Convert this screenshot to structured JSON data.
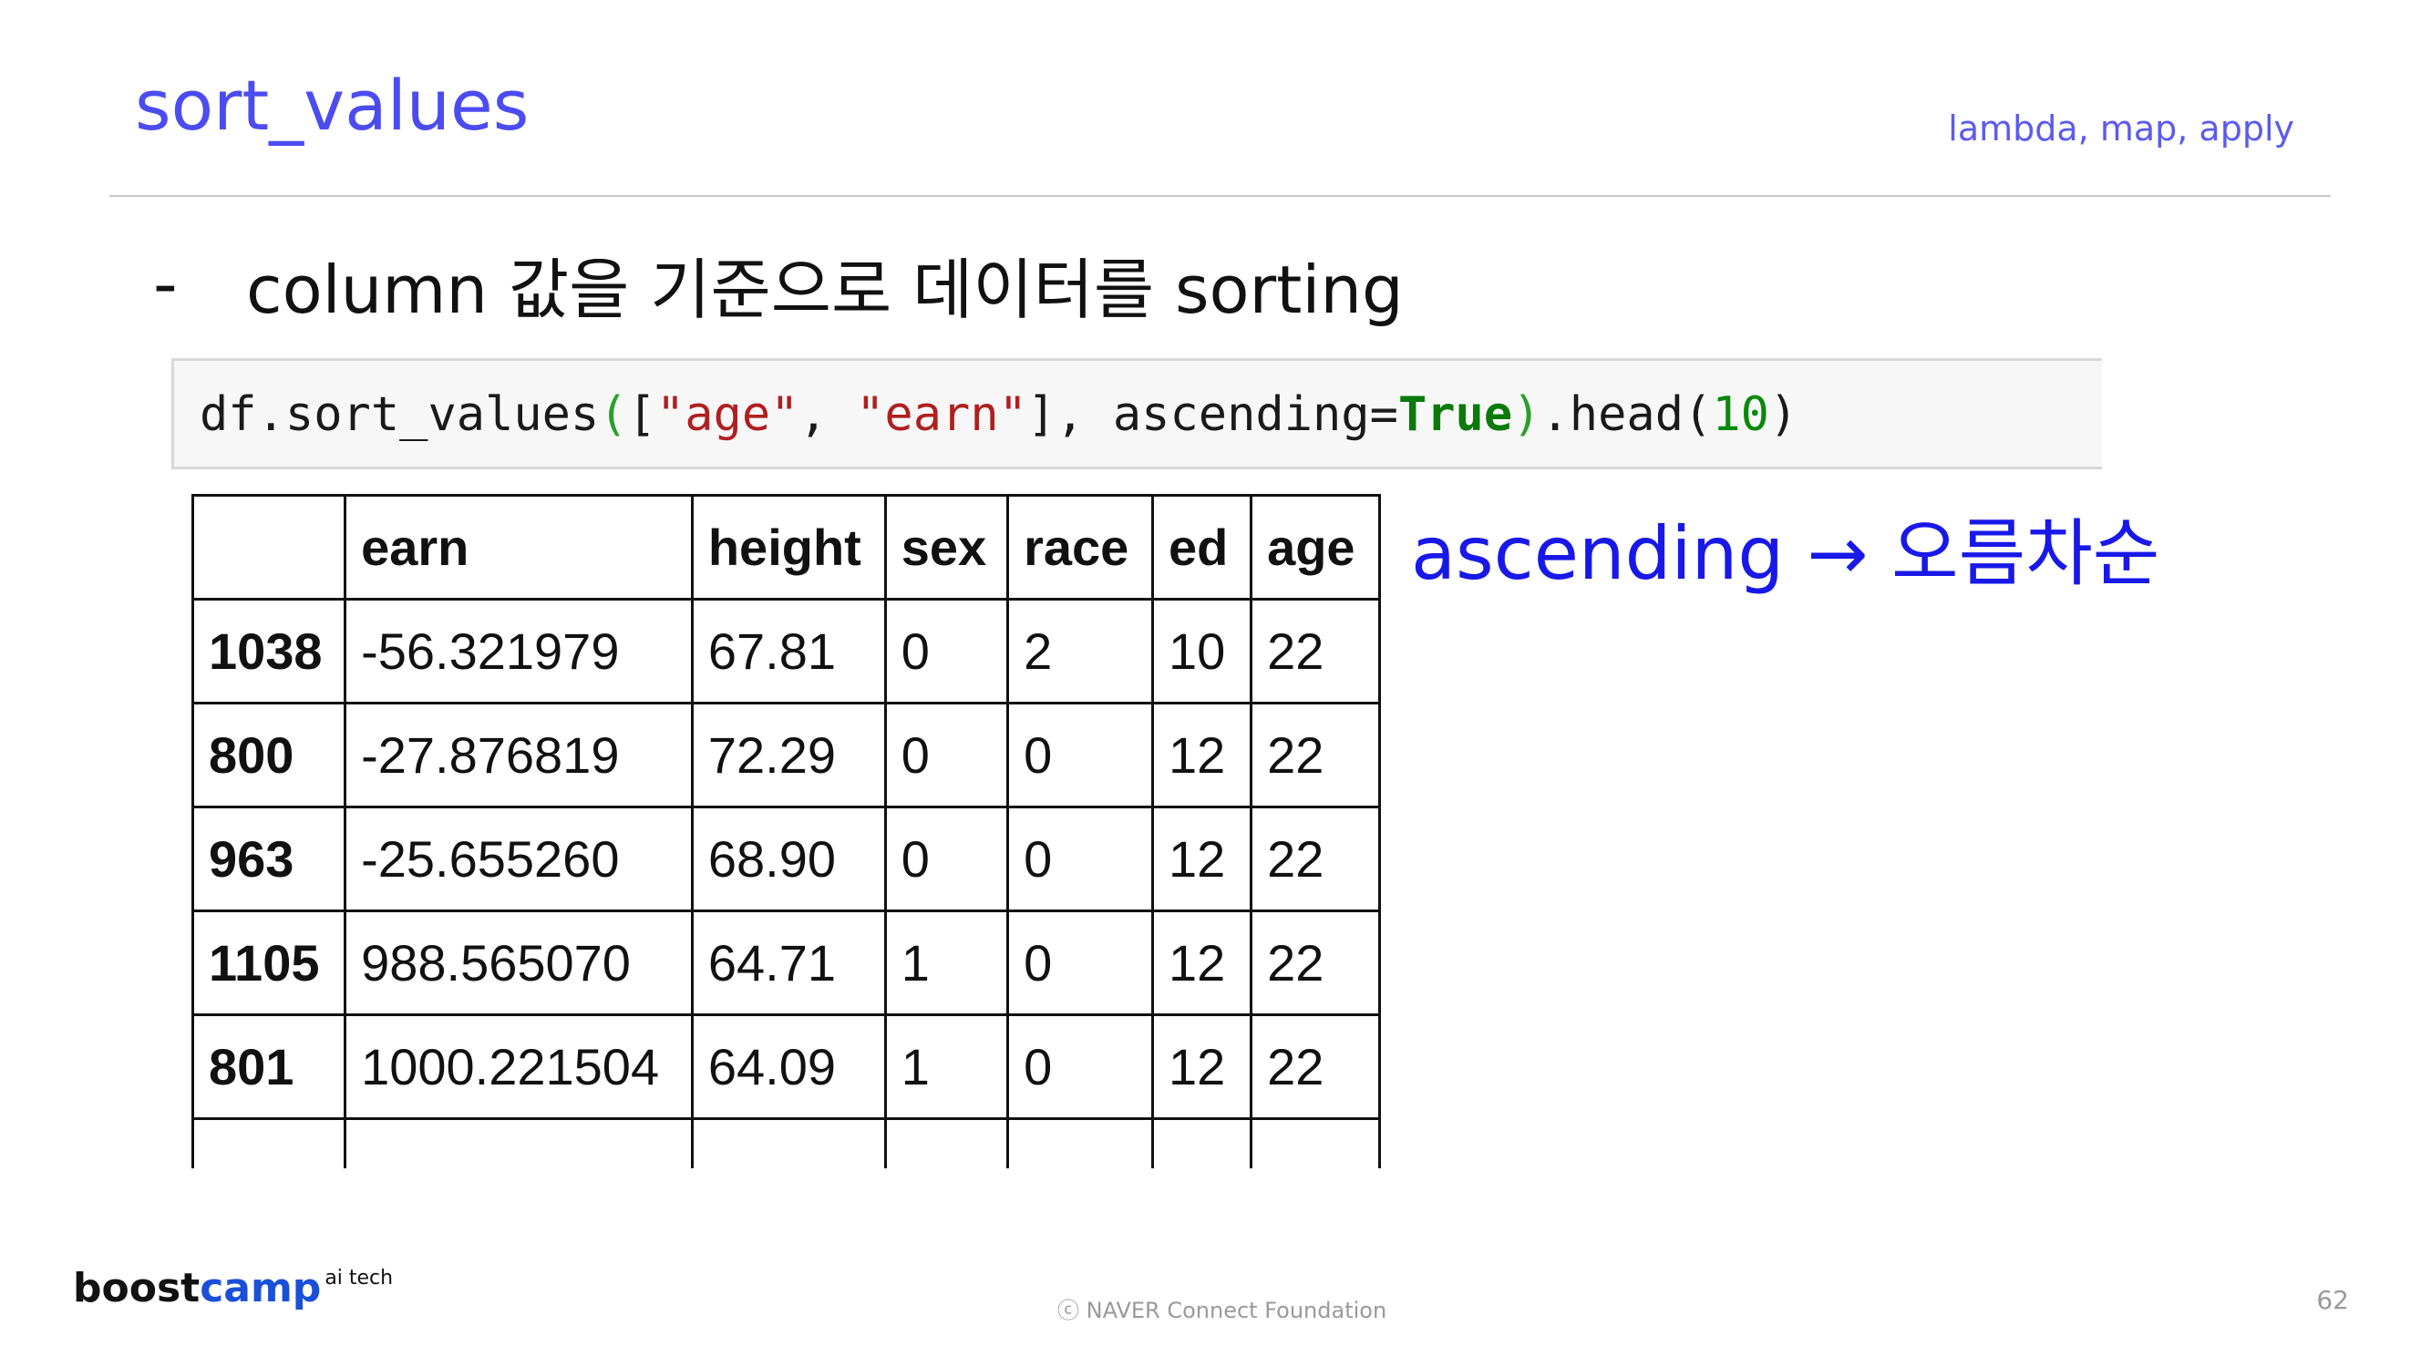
{
  "header": {
    "title": "sort_values",
    "section": "lambda, map, apply"
  },
  "bullet": {
    "marker": "-",
    "text": "column 값을 기준으로 데이터를 sorting"
  },
  "code": {
    "prefix": "df.sort_values",
    "open_paren": "(",
    "bracket_open": "[",
    "str1": "\"age\"",
    "comma1": ", ",
    "str2": "\"earn\"",
    "bracket_close": "], ascending=",
    "kw": "True",
    "close_paren": ")",
    "method": ".head(",
    "num": "10",
    "end": ")"
  },
  "table": {
    "columns": [
      "",
      "earn",
      "height",
      "sex",
      "race",
      "ed",
      "age"
    ],
    "rows": [
      [
        "1038",
        "-56.321979",
        "67.81",
        "0",
        "2",
        "10",
        "22"
      ],
      [
        "800",
        "-27.876819",
        "72.29",
        "0",
        "0",
        "12",
        "22"
      ],
      [
        "963",
        "-25.655260",
        "68.90",
        "0",
        "0",
        "12",
        "22"
      ],
      [
        "1105",
        "988.565070",
        "64.71",
        "1",
        "0",
        "12",
        "22"
      ],
      [
        "801",
        "1000.221504",
        "64.09",
        "1",
        "0",
        "12",
        "22"
      ],
      [
        "",
        "",
        "",
        "",
        "",
        "",
        ""
      ]
    ]
  },
  "annotation": {
    "text": "ascending → 오름차순"
  },
  "footer": {
    "logo_main": "boost",
    "logo_accent": "camp",
    "logo_sup": "ai tech",
    "copyright": "ⓒ  NAVER Connect Foundation",
    "page": "62"
  },
  "colors": {
    "accent": "#4b4cf0",
    "annotation": "#1818e8",
    "string": "#b01f1f",
    "keyword": "#0a7a0a"
  }
}
